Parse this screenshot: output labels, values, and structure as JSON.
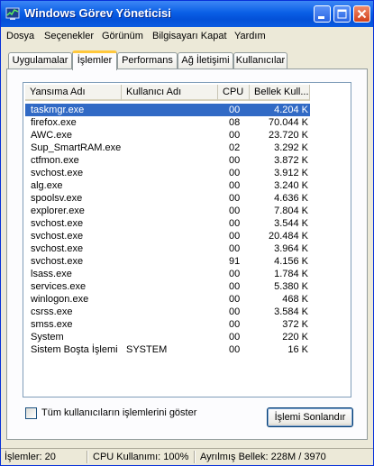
{
  "window": {
    "title": "Windows Görev Yöneticisi"
  },
  "menu": [
    "Dosya",
    "Seçenekler",
    "Görünüm",
    "Bilgisayarı Kapat",
    "Yardım"
  ],
  "tabs": [
    "Uygulamalar",
    "İşlemler",
    "Performans",
    "Ağ İletişimi",
    "Kullanıcılar"
  ],
  "active_tab": "İşlemler",
  "columns": [
    "Yansıma Adı",
    "Kullanıcı Adı",
    "CPU",
    "Bellek Kull..."
  ],
  "processes": [
    {
      "name": "taskmgr.exe",
      "user": "",
      "cpu": "00",
      "mem": "4.204 K",
      "selected": true
    },
    {
      "name": "firefox.exe",
      "user": "",
      "cpu": "08",
      "mem": "70.044 K"
    },
    {
      "name": "AWC.exe",
      "user": "",
      "cpu": "00",
      "mem": "23.720 K"
    },
    {
      "name": "Sup_SmartRAM.exe",
      "user": "",
      "cpu": "02",
      "mem": "3.292 K"
    },
    {
      "name": "ctfmon.exe",
      "user": "",
      "cpu": "00",
      "mem": "3.872 K"
    },
    {
      "name": "svchost.exe",
      "user": "",
      "cpu": "00",
      "mem": "3.912 K"
    },
    {
      "name": "alg.exe",
      "user": "",
      "cpu": "00",
      "mem": "3.240 K"
    },
    {
      "name": "spoolsv.exe",
      "user": "",
      "cpu": "00",
      "mem": "4.636 K"
    },
    {
      "name": "explorer.exe",
      "user": "",
      "cpu": "00",
      "mem": "7.804 K"
    },
    {
      "name": "svchost.exe",
      "user": "",
      "cpu": "00",
      "mem": "3.544 K"
    },
    {
      "name": "svchost.exe",
      "user": "",
      "cpu": "00",
      "mem": "20.484 K"
    },
    {
      "name": "svchost.exe",
      "user": "",
      "cpu": "00",
      "mem": "3.964 K"
    },
    {
      "name": "svchost.exe",
      "user": "",
      "cpu": "91",
      "mem": "4.156 K"
    },
    {
      "name": "lsass.exe",
      "user": "",
      "cpu": "00",
      "mem": "1.784 K"
    },
    {
      "name": "services.exe",
      "user": "",
      "cpu": "00",
      "mem": "5.380 K"
    },
    {
      "name": "winlogon.exe",
      "user": "",
      "cpu": "00",
      "mem": "468 K"
    },
    {
      "name": "csrss.exe",
      "user": "",
      "cpu": "00",
      "mem": "3.584 K"
    },
    {
      "name": "smss.exe",
      "user": "",
      "cpu": "00",
      "mem": "372 K"
    },
    {
      "name": "System",
      "user": "",
      "cpu": "00",
      "mem": "220 K"
    },
    {
      "name": "Sistem Boşta İşlemi",
      "user": "SYSTEM",
      "cpu": "00",
      "mem": "16 K"
    }
  ],
  "show_all_users_label": "Tüm kullanıcıların işlemlerini göster",
  "show_all_users_checked": false,
  "end_process_button": "İşlemi Sonlandır",
  "status": {
    "processes": "İşlemler: 20",
    "cpu_usage": "CPU Kullanımı: 100%",
    "commit_charge": "Ayrılmış Bellek: 228M / 3970"
  },
  "colors": {
    "titlebar": "#0a5fe6",
    "selection": "#316ac5",
    "active_tab_accent": "#ffc83c",
    "face": "#ece9d8"
  }
}
